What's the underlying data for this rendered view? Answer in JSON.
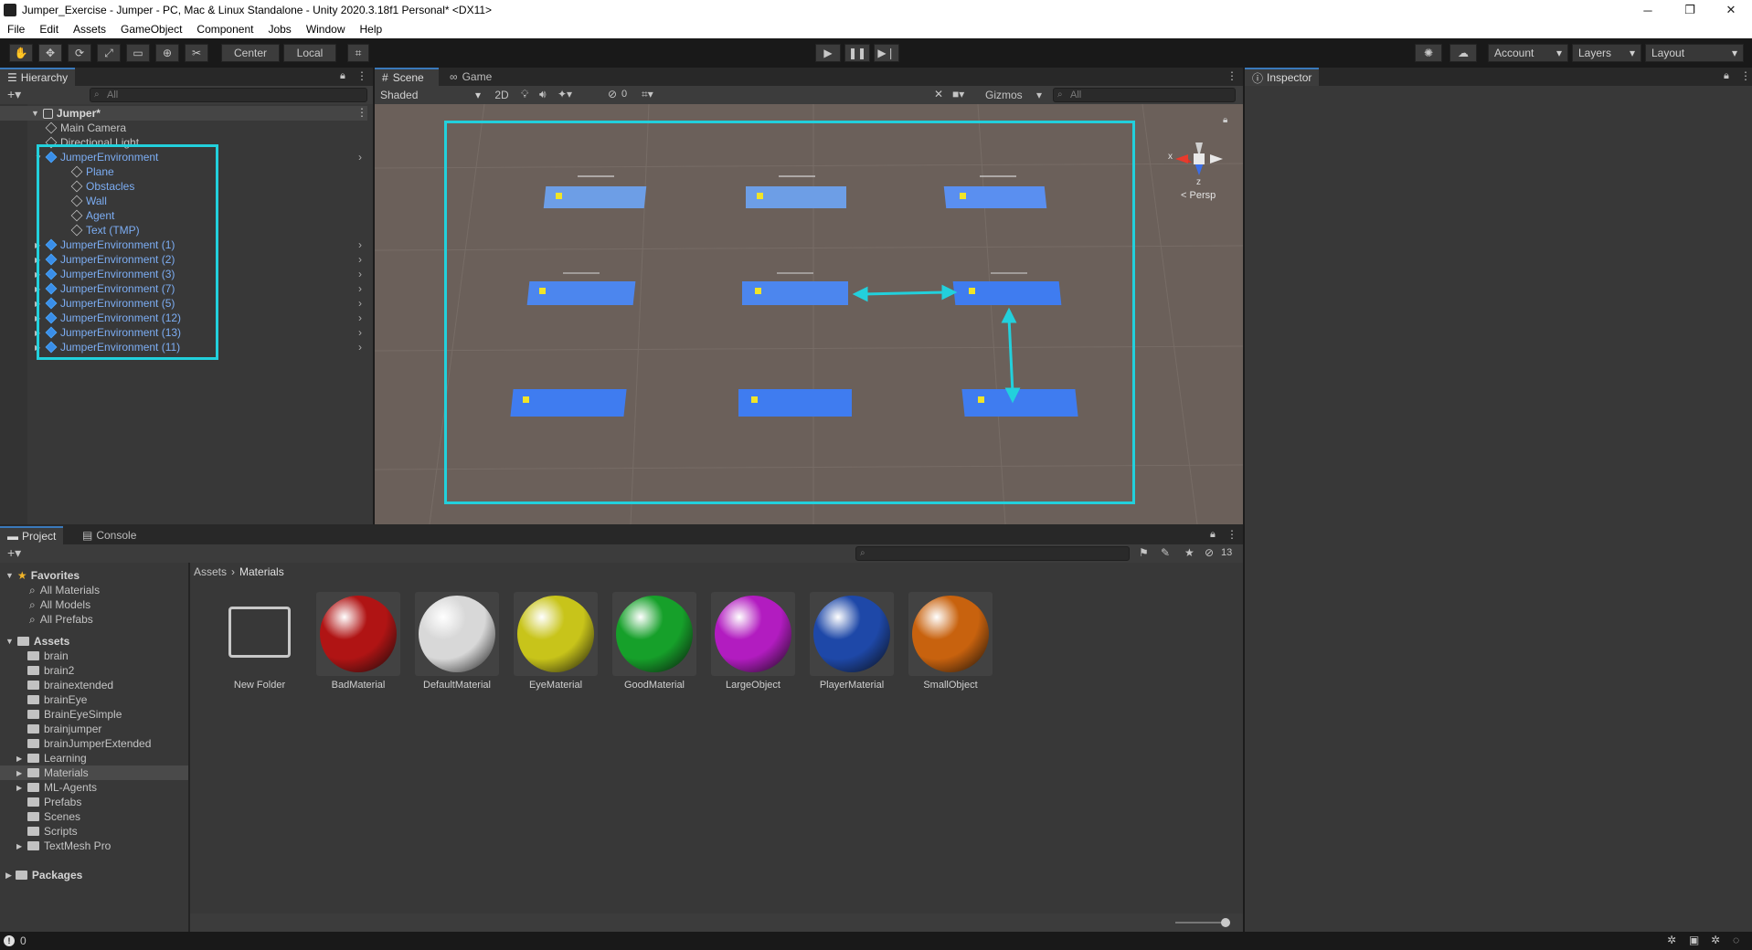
{
  "window": {
    "title": "Jumper_Exercise - Jumper - PC, Mac & Linux Standalone - Unity 2020.3.18f1 Personal* <DX11>",
    "controls": [
      "─",
      "❐",
      "✕"
    ]
  },
  "menu": [
    "File",
    "Edit",
    "Assets",
    "GameObject",
    "Component",
    "Jobs",
    "Window",
    "Help"
  ],
  "toolbar": {
    "pivot_mode": "Center",
    "pivot_rotation": "Local",
    "account": "Account",
    "layers": "Layers",
    "layout": "Layout"
  },
  "hierarchy": {
    "tab": "Hierarchy",
    "search_placeholder": "All",
    "scene": "Jumper*",
    "items": [
      {
        "label": "Main Camera",
        "level": 1,
        "blue": false
      },
      {
        "label": "Directional Light",
        "level": 1,
        "blue": false
      },
      {
        "label": "JumperEnvironment",
        "level": 1,
        "blue": true,
        "expanded": true
      },
      {
        "label": "Plane",
        "level": 2,
        "blue": true
      },
      {
        "label": "Obstacles",
        "level": 2,
        "blue": true
      },
      {
        "label": "Wall",
        "level": 2,
        "blue": true
      },
      {
        "label": "Agent",
        "level": 2,
        "blue": true
      },
      {
        "label": "Text (TMP)",
        "level": 2,
        "blue": true
      },
      {
        "label": "JumperEnvironment (1)",
        "level": 1,
        "blue": true
      },
      {
        "label": "JumperEnvironment (2)",
        "level": 1,
        "blue": true
      },
      {
        "label": "JumperEnvironment (3)",
        "level": 1,
        "blue": true
      },
      {
        "label": "JumperEnvironment (7)",
        "level": 1,
        "blue": true
      },
      {
        "label": "JumperEnvironment (5)",
        "level": 1,
        "blue": true
      },
      {
        "label": "JumperEnvironment (12)",
        "level": 1,
        "blue": true
      },
      {
        "label": "JumperEnvironment (13)",
        "level": 1,
        "blue": true
      },
      {
        "label": "JumperEnvironment (11)",
        "level": 1,
        "blue": true
      }
    ]
  },
  "scene": {
    "tabs": [
      "Scene",
      "Game"
    ],
    "shading": "Shaded",
    "mode_2d": "2D",
    "hidden_count": "0",
    "gizmos": "Gizmos",
    "search_placeholder": "All",
    "persp": "Persp",
    "axis_x": "x",
    "axis_z": "z"
  },
  "inspector": {
    "tab": "Inspector"
  },
  "project": {
    "tabs": [
      "Project",
      "Console"
    ],
    "hidden_count": "13",
    "breadcrumb": [
      "Assets",
      "Materials"
    ],
    "favorites_label": "Favorites",
    "favorites": [
      "All Materials",
      "All Models",
      "All Prefabs"
    ],
    "assets_label": "Assets",
    "folders": [
      {
        "label": "brain",
        "arrow": false
      },
      {
        "label": "brain2",
        "arrow": false
      },
      {
        "label": "brainextended",
        "arrow": false
      },
      {
        "label": "brainEye",
        "arrow": false
      },
      {
        "label": "BrainEyeSimple",
        "arrow": false
      },
      {
        "label": "brainjumper",
        "arrow": false
      },
      {
        "label": "brainJumperExtended",
        "arrow": false
      },
      {
        "label": "Learning",
        "arrow": true
      },
      {
        "label": "Materials",
        "arrow": true,
        "selected": true
      },
      {
        "label": "ML-Agents",
        "arrow": true
      },
      {
        "label": "Prefabs",
        "arrow": false
      },
      {
        "label": "Scenes",
        "arrow": false
      },
      {
        "label": "Scripts",
        "arrow": false
      },
      {
        "label": "TextMesh Pro",
        "arrow": true
      }
    ],
    "packages_label": "Packages",
    "assets": [
      {
        "label": "New Folder",
        "kind": "folder"
      },
      {
        "label": "BadMaterial",
        "color": "#b01414"
      },
      {
        "label": "DefaultMaterial",
        "color": "#d8d8d8"
      },
      {
        "label": "EyeMaterial",
        "color": "#c8c41a"
      },
      {
        "label": "GoodMaterial",
        "color": "#16a02a"
      },
      {
        "label": "LargeObject",
        "color": "#b21cc0"
      },
      {
        "label": "PlayerMaterial",
        "color": "#1e48a8"
      },
      {
        "label": "SmallObject",
        "color": "#c8620e"
      }
    ]
  },
  "statusbar": {
    "count": "0"
  }
}
